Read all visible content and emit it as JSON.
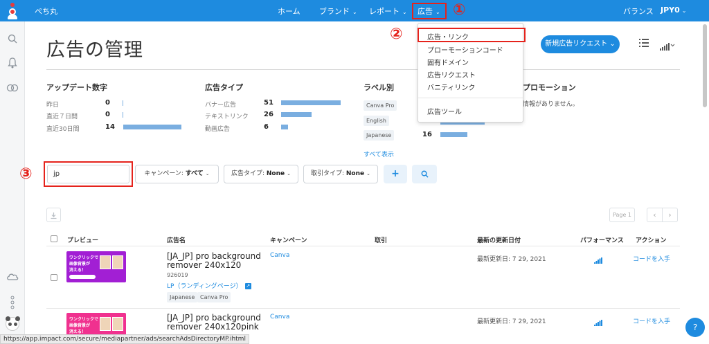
{
  "header": {
    "brand": "ぺち丸",
    "nav": {
      "home": "ホーム",
      "brand": "ブランド",
      "report": "レポート",
      "ads": "広告"
    },
    "balance_label": "バランス",
    "currency": "JPY0",
    "annotation_1": "①"
  },
  "page": {
    "title": "広告の管理",
    "new_request": "新規広告リクエスト",
    "new_request_chevron": "⌄"
  },
  "dropdown": {
    "annotation": "②",
    "items": [
      "広告・リンク",
      "プローモーションコード",
      "固有ドメイン",
      "広告リクエスト",
      "バニティリンク",
      "広告ツール"
    ]
  },
  "stats": {
    "update_counts": {
      "title": "アップデート数字",
      "rows": [
        {
          "label": "昨日",
          "value": "0",
          "fraction": 0.0
        },
        {
          "label": "直近７日間",
          "value": "0",
          "fraction": 0.0
        },
        {
          "label": "直近30日間",
          "value": "14",
          "fraction": 1.0
        }
      ]
    },
    "ad_types": {
      "title": "広告タイプ",
      "rows": [
        {
          "label": "バナー広告",
          "value": "51",
          "fraction": 1.0
        },
        {
          "label": "テキストリンク",
          "value": "26",
          "fraction": 0.51
        },
        {
          "label": "動画広告",
          "value": "6",
          "fraction": 0.12
        }
      ]
    },
    "labels": {
      "title": "ラベル別",
      "rows": [
        {
          "label": "Canva Pro",
          "value": ""
        },
        {
          "label": "English",
          "value": ""
        },
        {
          "label": "Japanese",
          "value": "16"
        }
      ],
      "show_all": "すべて表示"
    },
    "promotions": {
      "title": "プロモーション",
      "note": "情報がありません。"
    }
  },
  "filters": {
    "annotation": "③",
    "search_value": "jp",
    "campaign_label": "キャンペーン: ",
    "campaign_value": "すべて",
    "ad_type_label": "広告タイプ: ",
    "ad_type_value": "None",
    "deal_type_label": "取引タイプ: ",
    "deal_type_value": "None",
    "plus": "+"
  },
  "pagination": {
    "page_label": "Page 1",
    "prev": "‹",
    "next": "›"
  },
  "table": {
    "headers": {
      "preview": "プレビュー",
      "ad_name": "広告名",
      "campaign": "キャンペーン",
      "deal": "取引",
      "updated": "最新の更新日付",
      "performance": "パフォーマンス",
      "action": "アクション"
    },
    "rows": [
      {
        "name": "[JA_JP] pro background remover 240x120",
        "id": "926019",
        "lp": "LP（ランディングページ）",
        "campaign": "Canva",
        "updated": "最新更新日: 7 29, 2021",
        "action": "コードを入手",
        "tags": [
          "Japanese",
          "Canva Pro"
        ],
        "thumb_text": "ワンクリックで\n画像背景が\n消える！",
        "thumb_color": "#a21fd4"
      },
      {
        "name": "[JA_JP] pro background remover 240x120pink",
        "campaign": "Canva",
        "updated": "最新更新日: 7 29, 2021",
        "action": "コードを入手",
        "thumb_text": "ワンクリックで\n画像背景が\n消える！",
        "thumb_color": "#f0318f"
      }
    ]
  },
  "status_url": "https://app.impact.com/secure/mediapartner/ads/searchAdsDirectoryMP.ihtml",
  "colors": {
    "primary": "#1e8bdf",
    "annotation_red": "#e5231c",
    "bar": "#7aaee0"
  }
}
